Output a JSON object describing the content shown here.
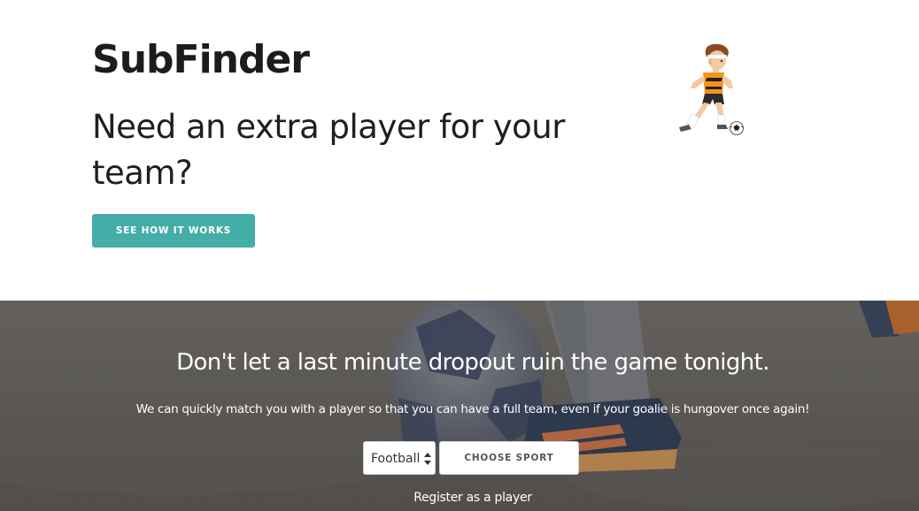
{
  "hero": {
    "brand": "SubFinder",
    "tagline": "Need an extra player for your team?",
    "cta_label": "SEE HOW IT WORKS",
    "illustration_icon": "soccer-player-illustration"
  },
  "banner": {
    "title": "Don't let a last minute dropout ruin the game tonight.",
    "subtitle": "We can quickly match you with a player so that you can have a full team, even if your goalie is hungover once again!",
    "sport_select": {
      "selected": "Football"
    },
    "choose_label": "CHOOSE SPORT",
    "register_link": "Register as a player"
  },
  "colors": {
    "accent": "#45ada8",
    "text_dark": "#1c1c1c",
    "banner_overlay": "#6e6a66"
  }
}
